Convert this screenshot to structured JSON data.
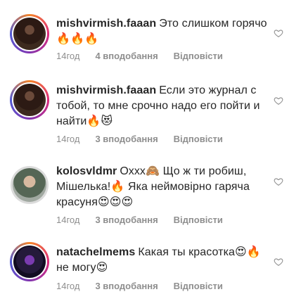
{
  "comments": [
    {
      "username": "mishvirmish.faaan",
      "text": "Это слишком горячо🔥🔥🔥",
      "time": "14год",
      "likes": "4 вподобання",
      "reply": "Відповісти"
    },
    {
      "username": "mishvirmish.faaan",
      "text": "Если это журнал с тобой, то мне срочно надо его пойти и найти🔥😻",
      "time": "14год",
      "likes": "3 вподобання",
      "reply": "Відповісти"
    },
    {
      "username": "kolosvldmr",
      "text": "Оххх🙈 Що ж ти робиш, Мішелька!🔥 Яка неймовірно гаряча красуня😍😍😍",
      "time": "14год",
      "likes": "3 вподобання",
      "reply": "Відповісти"
    },
    {
      "username": "natachelmems",
      "text": "Какая ты красотка😍🔥 не могу😍",
      "time": "14год",
      "likes": "3 вподобання",
      "reply": "Відповісти"
    }
  ],
  "icons": {
    "like": "heart-outline-icon"
  },
  "colors": {
    "muted": "#8e8e8e",
    "text": "#262626"
  }
}
